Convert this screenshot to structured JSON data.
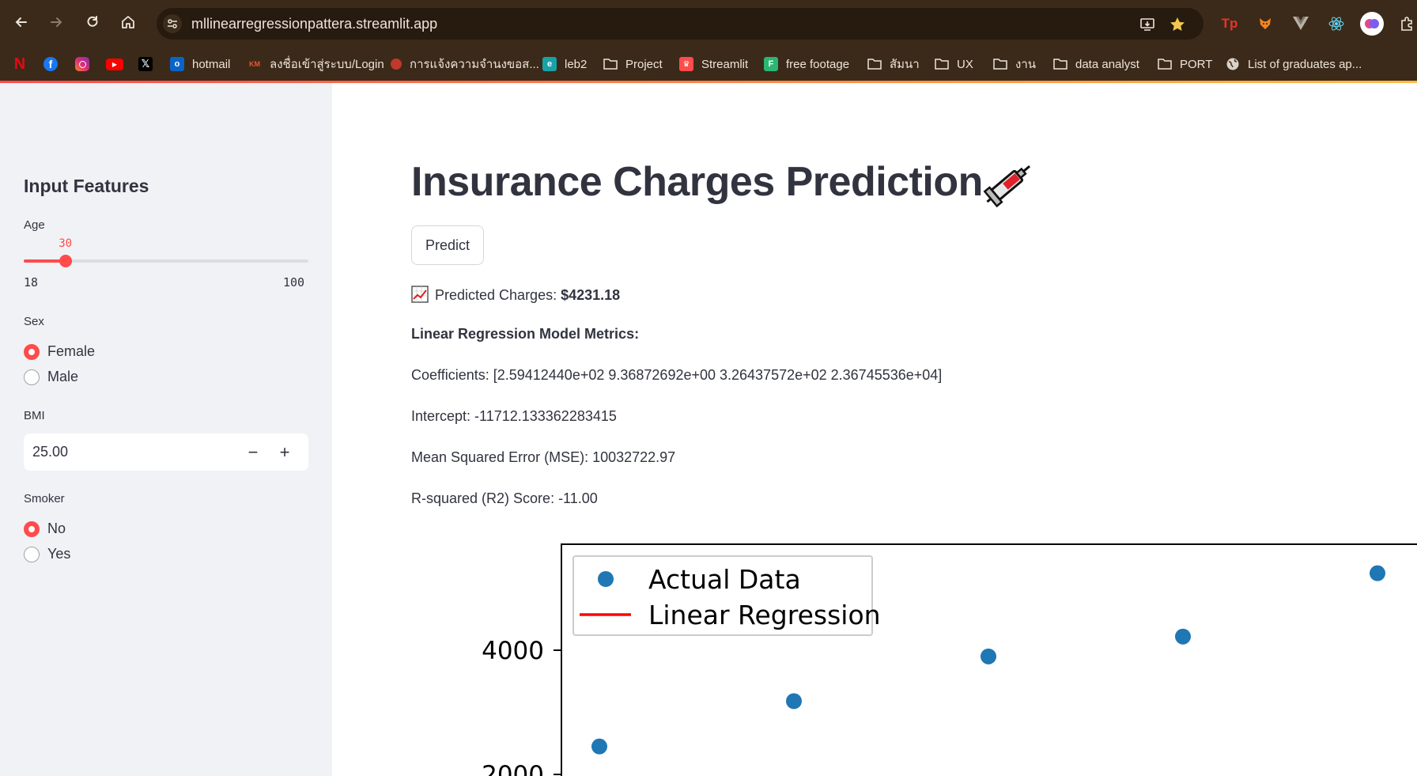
{
  "browser": {
    "url": "mllinearregressionpattera.streamlit.app",
    "bookmarks": [
      {
        "label": "",
        "icon": "netflix-icon",
        "color": "#e50914"
      },
      {
        "label": "",
        "icon": "facebook-icon",
        "color": "#1877f2"
      },
      {
        "label": "",
        "icon": "instagram-icon",
        "color": "#d6249f"
      },
      {
        "label": "",
        "icon": "youtube-icon",
        "color": "#ff0000"
      },
      {
        "label": "",
        "icon": "x-icon",
        "color": "#000000"
      },
      {
        "label": "hotmail",
        "icon": "outlook-icon",
        "color": "#0a64c8"
      },
      {
        "label": "ลงชื่อเข้าสู่ระบบ/Login",
        "icon": "kmutt-icon",
        "color": "#e8582c"
      },
      {
        "label": "การแจ้งความจำนงขอส...",
        "icon": "ladybug-icon",
        "color": "#c0392b"
      },
      {
        "label": "leb2",
        "icon": "leb2-icon",
        "color": "#17a2a8"
      },
      {
        "label": "Project",
        "icon": "folder-icon",
        "color": "transparent"
      },
      {
        "label": "Streamlit",
        "icon": "streamlit-icon",
        "color": "#ff4b4b"
      },
      {
        "label": "free footage",
        "icon": "footage-icon",
        "color": "#2bb673"
      },
      {
        "label": "สัมนา",
        "icon": "folder-icon",
        "color": "transparent"
      },
      {
        "label": "UX",
        "icon": "folder-icon",
        "color": "transparent"
      },
      {
        "label": "งาน",
        "icon": "folder-icon",
        "color": "transparent"
      },
      {
        "label": "data analyst",
        "icon": "folder-icon",
        "color": "transparent"
      },
      {
        "label": "PORT",
        "icon": "folder-icon",
        "color": "transparent"
      },
      {
        "label": "List of graduates ap...",
        "icon": "globe-icon",
        "color": "transparent"
      }
    ]
  },
  "sidebar": {
    "title": "Input Features",
    "age": {
      "label": "Age",
      "value": 30,
      "min": 18,
      "max": 100
    },
    "sex": {
      "label": "Sex",
      "options": [
        "Female",
        "Male"
      ],
      "selected": "Female"
    },
    "bmi": {
      "label": "BMI",
      "value": "25.00",
      "decrement": "−",
      "increment": "+"
    },
    "smoker": {
      "label": "Smoker",
      "options": [
        "No",
        "Yes"
      ],
      "selected": "No"
    }
  },
  "main": {
    "title": "Insurance Charges Prediction",
    "predict_button": "Predict",
    "prediction_label": "Predicted Charges: ",
    "prediction_value": "$4231.18",
    "metrics_heading": "Linear Regression Model Metrics:",
    "coefficients": "Coefficients: [2.59412440e+02 9.36872692e+00 3.26437572e+02 2.36745536e+04]",
    "intercept": "Intercept: -11712.133362283415",
    "mse": "Mean Squared Error (MSE): 10032722.97",
    "r2": "R-squared (R2) Score: -11.00"
  },
  "chart_data": {
    "type": "scatter",
    "title": "",
    "xlabel": "",
    "ylabel": "",
    "legend": [
      "Actual Data",
      "Linear Regression"
    ],
    "legend_position": "top-left",
    "y_ticks": [
      2000,
      4000
    ],
    "series": [
      {
        "name": "Actual Data",
        "color": "#1f77b4",
        "points": [
          [
            1,
            2450
          ],
          [
            2,
            3180
          ],
          [
            3,
            3900
          ],
          [
            4,
            4220
          ],
          [
            5,
            5240
          ]
        ]
      },
      {
        "name": "Linear Regression",
        "color": "#ff0000",
        "points": []
      }
    ]
  }
}
